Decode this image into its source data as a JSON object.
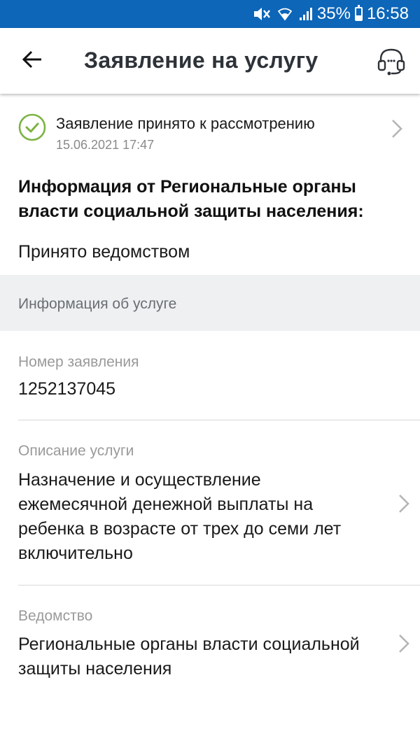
{
  "status_bar": {
    "battery": "35%",
    "time": "16:58",
    "battery_level": 0.35,
    "icons": [
      "mute-icon",
      "wifi-icon",
      "signal-icon",
      "battery-icon"
    ]
  },
  "header": {
    "title": "Заявление на услугу",
    "back_icon": "arrow-left-icon",
    "support_icon": "headset-icon"
  },
  "application_status": {
    "title": "Заявление принято к рассмотрению",
    "date": "15.06.2021 17:47",
    "icon": "check-circle-icon",
    "icon_color": "#7cb342"
  },
  "agency_info": {
    "heading_line1": "Информация от Региональные органы",
    "heading_line2": "власти социальной защиты населения:",
    "text": "Принято ведомством"
  },
  "section": {
    "title": "Информация об услуге"
  },
  "fields": {
    "number": {
      "label": "Номер заявления",
      "value": "1252137045"
    },
    "description": {
      "label": "Описание услуги",
      "line1": "Назначение и осуществление",
      "line2": "ежемесячной денежной выплаты на",
      "line3": "ребенка в возрасте от трех до семи лет",
      "line4": "включительно"
    },
    "agency": {
      "label": "Ведомство",
      "line1": "Региональные органы власти социальной",
      "line2": "защиты населения"
    }
  },
  "colors": {
    "status_bar": "#0d66b8",
    "accent_green": "#7cb342",
    "section_bg": "#eef0f1"
  }
}
